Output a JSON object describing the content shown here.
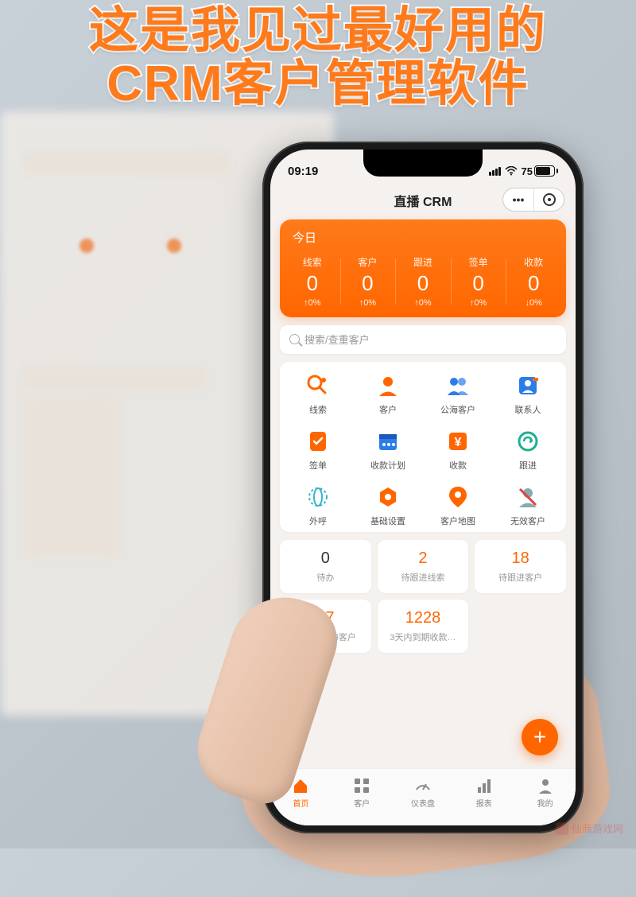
{
  "headline_l1": "这是我见过最好用的",
  "headline_l2": "CRM客户管理软件",
  "status": {
    "time": "09:19",
    "battery": "75"
  },
  "nav": {
    "title": "直播 CRM"
  },
  "today": {
    "title": "今日",
    "stats": [
      {
        "label": "线索",
        "value": "0",
        "delta": "↑0%"
      },
      {
        "label": "客户",
        "value": "0",
        "delta": "↑0%"
      },
      {
        "label": "跟进",
        "value": "0",
        "delta": "↑0%"
      },
      {
        "label": "签单",
        "value": "0",
        "delta": "↑0%"
      },
      {
        "label": "收款",
        "value": "0",
        "delta": "↓0%"
      }
    ]
  },
  "search": {
    "placeholder": "搜索/查重客户"
  },
  "apps": [
    {
      "label": "线索"
    },
    {
      "label": "客户"
    },
    {
      "label": "公海客户"
    },
    {
      "label": "联系人"
    },
    {
      "label": "签单"
    },
    {
      "label": "收款计划"
    },
    {
      "label": "收款"
    },
    {
      "label": "跟进"
    },
    {
      "label": "外呼"
    },
    {
      "label": "基础设置"
    },
    {
      "label": "客户地图"
    },
    {
      "label": "无效客户"
    }
  ],
  "tiles": [
    {
      "num": "0",
      "label": "待办",
      "orange": false
    },
    {
      "num": "2",
      "label": "待跟进线索",
      "orange": true
    },
    {
      "num": "18",
      "label": "待跟进客户",
      "orange": true
    },
    {
      "num": "17",
      "label": "即将丢公海客户",
      "orange": true
    },
    {
      "num": "1228",
      "label": "3天内到期收款…",
      "orange": true
    }
  ],
  "tabs": [
    {
      "label": "首页",
      "active": true
    },
    {
      "label": "客户",
      "active": false
    },
    {
      "label": "仪表盘",
      "active": false
    },
    {
      "label": "报表",
      "active": false
    },
    {
      "label": "我的",
      "active": false
    }
  ],
  "watermark": "仙商游戏网"
}
